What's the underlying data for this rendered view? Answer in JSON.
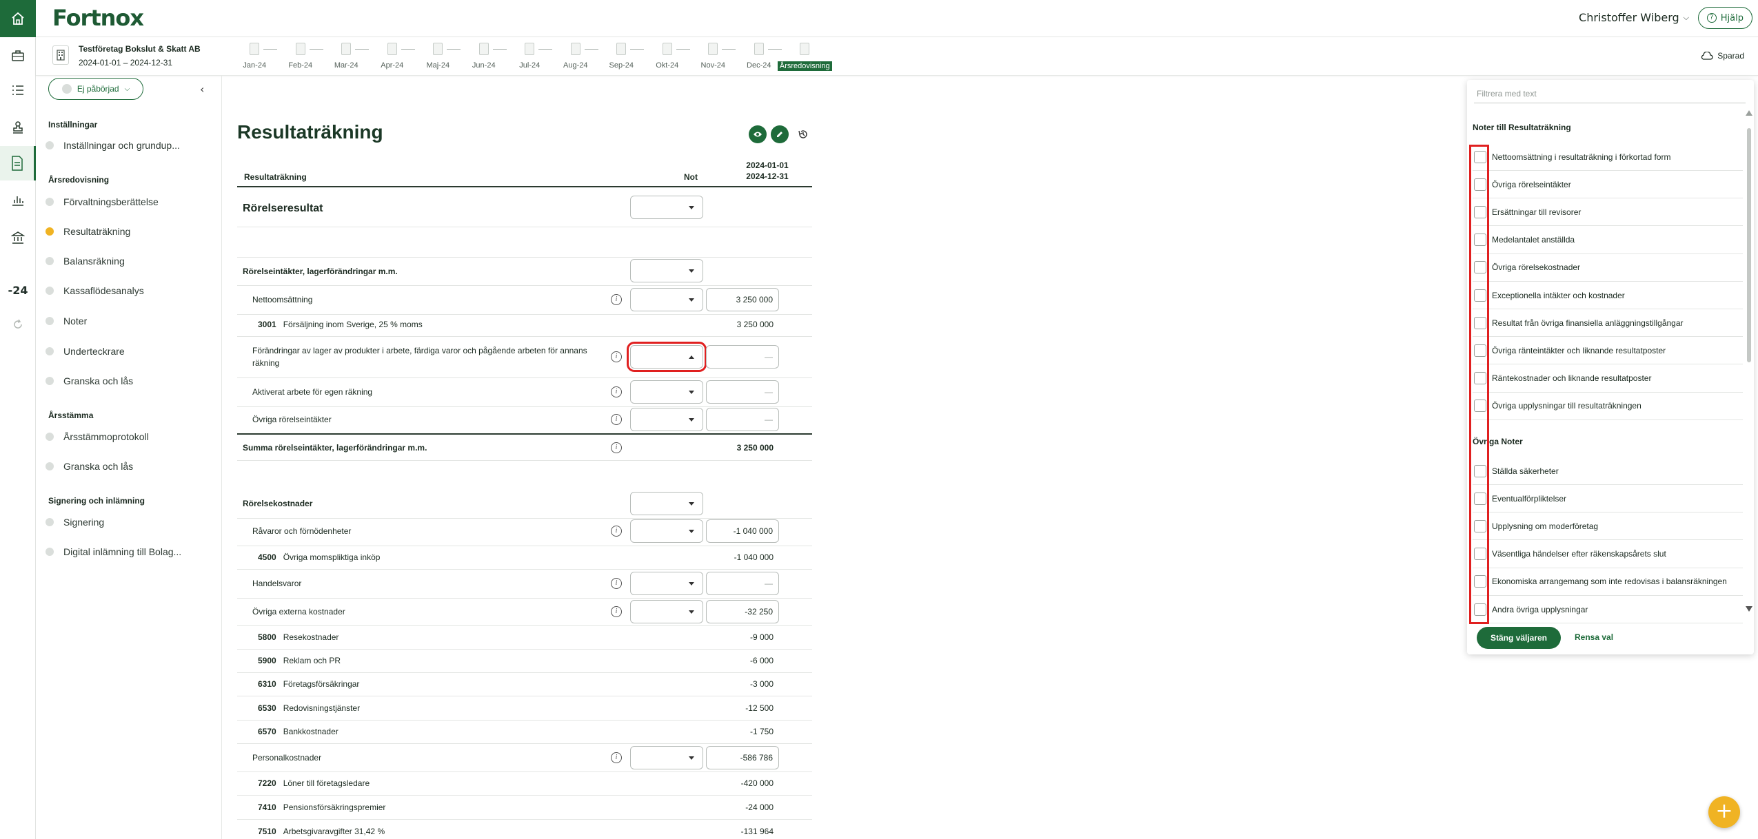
{
  "app": {
    "logo": "Fortnox",
    "user_name": "Christoffer Wiberg",
    "help_label": "Hjälp",
    "saved_label": "Sparad"
  },
  "rail": {
    "year_label": "-24"
  },
  "company": {
    "name": "Testföretag Bokslut & Skatt AB",
    "period": "2024-01-01 – 2024-12-31"
  },
  "months": [
    "Jan-24",
    "Feb-24",
    "Mar-24",
    "Apr-24",
    "Maj-24",
    "Jun-24",
    "Jul-24",
    "Aug-24",
    "Sep-24",
    "Okt-24",
    "Nov-24",
    "Dec-24",
    "Årsredovisning"
  ],
  "nav": {
    "status": "Ej påbörjad",
    "sections": [
      {
        "heading": "Inställningar",
        "items": [
          "Inställningar och grundup..."
        ]
      },
      {
        "heading": "Årsredovisning",
        "items": [
          "Förvaltningsberättelse",
          "Resultaträkning",
          "Balansräkning",
          "Kassaflödesanalys",
          "Noter",
          "Underteckrare",
          "Granska och lås"
        ]
      },
      {
        "heading": "Årsstämma",
        "items": [
          "Årsstämmoprotokoll",
          "Granska och lås"
        ]
      },
      {
        "heading": "Signering och inlämning",
        "items": [
          "Signering",
          "Digital inlämning till Bolag..."
        ]
      }
    ]
  },
  "main": {
    "title": "Resultaträkning",
    "col_label": "Resultaträkning",
    "col_not": "Not",
    "col_period_1": "2024-01-01",
    "col_period_2": "2024-12-31",
    "section_rorelseresultat": "Rörelseresultat",
    "group_intakter": "Rörelseintäkter, lagerförändringar m.m.",
    "nettoomsattning": "Nettoomsättning",
    "nettoomsattning_value": "3 250 000",
    "acct_3001": "3001",
    "acct_3001_label": "Försäljning inom Sverige, 25 % moms",
    "acct_3001_value": "3 250 000",
    "forandringar_line1": "Förändringar av lager av produkter i arbete, färdiga varor och pågående arbeten för annans",
    "forandringar_line2": "räkning",
    "aktiverat": "Aktiverat arbete för egen räkning",
    "ovriga_intakter": "Övriga rörelseintäkter",
    "summa_intakter": "Summa rörelseintäkter, lagerförändringar m.m.",
    "summa_intakter_value": "3 250 000",
    "group_kostnader": "Rörelsekostnader",
    "ravaror": "Råvaror och förnödenheter",
    "ravaror_value": "-1 040 000",
    "acct_4500": "4500",
    "acct_4500_label": "Övriga momspliktiga inköp",
    "acct_4500_value": "-1 040 000",
    "handelsvaror": "Handelsvaror",
    "externa": "Övriga externa kostnader",
    "externa_value": "-32 250",
    "accts_ext": [
      {
        "code": "5800",
        "label": "Resekostnader",
        "value": "-9 000"
      },
      {
        "code": "5900",
        "label": "Reklam och PR",
        "value": "-6 000"
      },
      {
        "code": "6310",
        "label": "Företagsförsäkringar",
        "value": "-3 000"
      },
      {
        "code": "6530",
        "label": "Redovisningstjänster",
        "value": "-12 500"
      },
      {
        "code": "6570",
        "label": "Bankkostnader",
        "value": "-1 750"
      }
    ],
    "personal": "Personalkostnader",
    "personal_value": "-586 786",
    "accts_pers": [
      {
        "code": "7220",
        "label": "Löner till företagsledare",
        "value": "-420 000"
      },
      {
        "code": "7410",
        "label": "Pensionsförsäkringspremier",
        "value": "-24 000"
      },
      {
        "code": "7510",
        "label": "Arbetsgivaravgifter 31,42 %",
        "value": "-131 964"
      }
    ],
    "empty_dash": "—"
  },
  "panel": {
    "filter_placeholder": "Filtrera med text",
    "section1": "Noter till Resultaträkning",
    "items1": [
      "Nettoomsättning i resultaträkning i förkortad form",
      "Övriga rörelseintäkter",
      "Ersättningar till revisorer",
      "Medelantalet anställda",
      "Övriga rörelsekostnader",
      "Exceptionella intäkter och kostnader",
      "Resultat från övriga finansiella anläggningstillgångar",
      "Övriga ränteintäkter och liknande resultatposter",
      "Räntekostnader och liknande resultatposter",
      "Övriga upplysningar till resultaträkningen"
    ],
    "section2": "Övriga Noter",
    "items2": [
      "Ställda säkerheter",
      "Eventualförpliktelser",
      "Upplysning om moderföretag",
      "Väsentliga händelser efter räkenskapsårets slut",
      "Ekonomiska arrangemang som inte redovisas i balansräkningen",
      "Andra övriga upplysningar"
    ],
    "close_label": "Stäng väljaren",
    "clear_label": "Rensa val"
  },
  "colors": {
    "brand": "#1e6b3a",
    "accent": "#f0b323",
    "highlight": "#e02020"
  }
}
